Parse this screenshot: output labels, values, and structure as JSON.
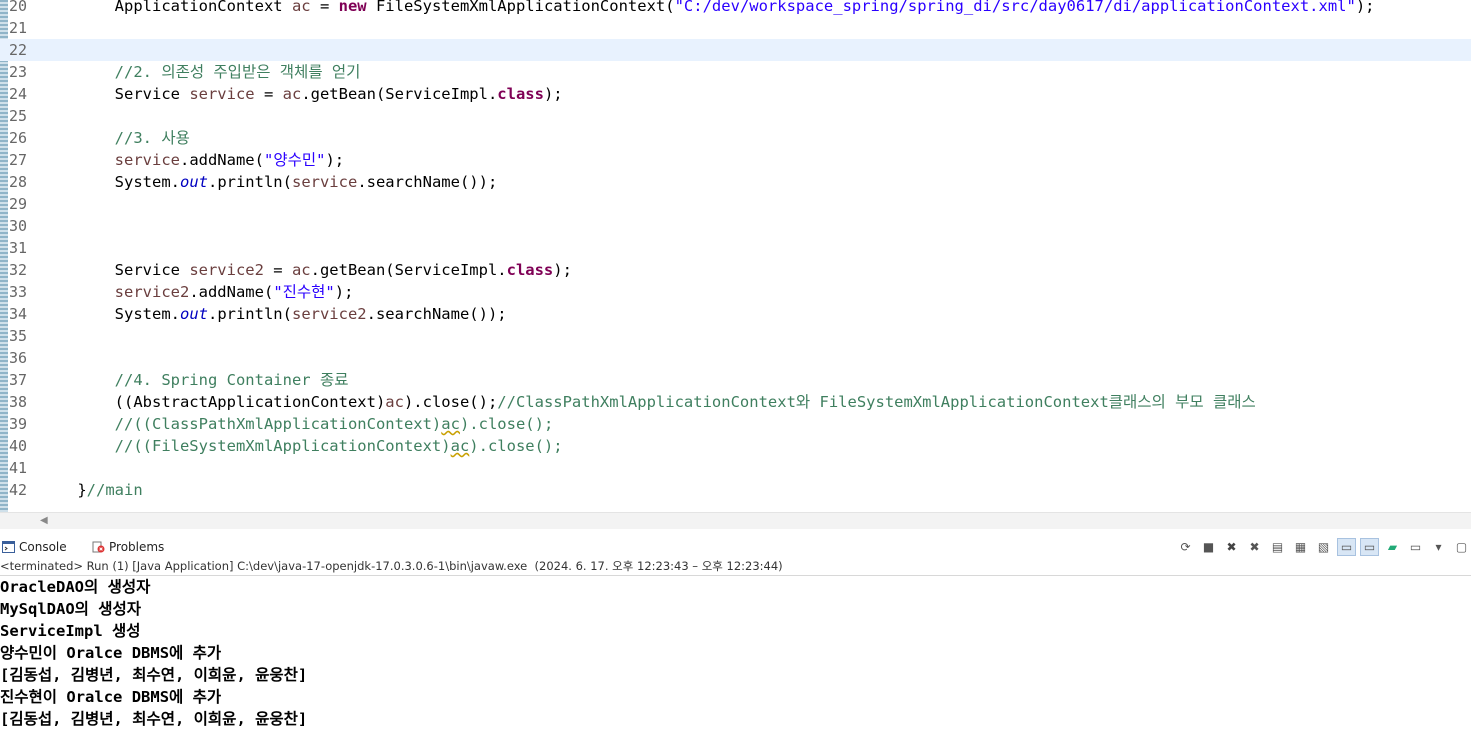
{
  "editor": {
    "lines": [
      {
        "num": "20",
        "segs": [
          {
            "t": "        ApplicationContext "
          },
          {
            "t": "ac",
            "c": "var"
          },
          {
            "t": " = "
          },
          {
            "t": "new",
            "c": "kw"
          },
          {
            "t": " FileSystemXmlApplicationContext("
          },
          {
            "t": "\"C:/dev/workspace_spring/spring_di/src/day0617/di/applicationContext.xml\"",
            "c": "str"
          },
          {
            "t": ");"
          }
        ]
      },
      {
        "num": "21",
        "segs": []
      },
      {
        "num": "22",
        "segs": [],
        "current": true
      },
      {
        "num": "23",
        "segs": [
          {
            "t": "        //2. 의존성 주입받은 객체를 얻기",
            "c": "cm"
          }
        ]
      },
      {
        "num": "24",
        "segs": [
          {
            "t": "        Service "
          },
          {
            "t": "service",
            "c": "var"
          },
          {
            "t": " = "
          },
          {
            "t": "ac",
            "c": "var"
          },
          {
            "t": ".getBean(ServiceImpl."
          },
          {
            "t": "class",
            "c": "kw"
          },
          {
            "t": ");"
          }
        ]
      },
      {
        "num": "25",
        "segs": []
      },
      {
        "num": "26",
        "segs": [
          {
            "t": "        //3. 사용",
            "c": "cm"
          }
        ]
      },
      {
        "num": "27",
        "segs": [
          {
            "t": "        "
          },
          {
            "t": "service",
            "c": "var"
          },
          {
            "t": ".addName("
          },
          {
            "t": "\"양수민\"",
            "c": "str"
          },
          {
            "t": ");"
          }
        ]
      },
      {
        "num": "28",
        "segs": [
          {
            "t": "        System."
          },
          {
            "t": "out",
            "c": "st"
          },
          {
            "t": ".println("
          },
          {
            "t": "service",
            "c": "var"
          },
          {
            "t": ".searchName());"
          }
        ]
      },
      {
        "num": "29",
        "segs": []
      },
      {
        "num": "30",
        "segs": []
      },
      {
        "num": "31",
        "segs": []
      },
      {
        "num": "32",
        "segs": [
          {
            "t": "        Service "
          },
          {
            "t": "service2",
            "c": "var"
          },
          {
            "t": " = "
          },
          {
            "t": "ac",
            "c": "var"
          },
          {
            "t": ".getBean(ServiceImpl."
          },
          {
            "t": "class",
            "c": "kw"
          },
          {
            "t": ");"
          }
        ]
      },
      {
        "num": "33",
        "segs": [
          {
            "t": "        "
          },
          {
            "t": "service2",
            "c": "var"
          },
          {
            "t": ".addName("
          },
          {
            "t": "\"진수현\"",
            "c": "str"
          },
          {
            "t": ");"
          }
        ]
      },
      {
        "num": "34",
        "segs": [
          {
            "t": "        System."
          },
          {
            "t": "out",
            "c": "st"
          },
          {
            "t": ".println("
          },
          {
            "t": "service2",
            "c": "var"
          },
          {
            "t": ".searchName());"
          }
        ]
      },
      {
        "num": "35",
        "segs": []
      },
      {
        "num": "36",
        "segs": []
      },
      {
        "num": "37",
        "segs": [
          {
            "t": "        //4. Spring Container 종료",
            "c": "cm"
          }
        ]
      },
      {
        "num": "38",
        "segs": [
          {
            "t": "        ((AbstractApplicationContext)"
          },
          {
            "t": "ac",
            "c": "var"
          },
          {
            "t": ").close();"
          },
          {
            "t": "//ClassPathXmlApplicationContext와 FileSystemXmlApplicationContext클래스의 부모 클래스",
            "c": "cm"
          }
        ]
      },
      {
        "num": "39",
        "segs": [
          {
            "t": "        //((ClassPathXmlApplicationContext)",
            "c": "cm"
          },
          {
            "t": "ac",
            "c": "cm wavy"
          },
          {
            "t": ").close();",
            "c": "cm"
          }
        ]
      },
      {
        "num": "40",
        "segs": [
          {
            "t": "        //((FileSystemXmlApplicationContext)",
            "c": "cm"
          },
          {
            "t": "ac",
            "c": "cm wavy"
          },
          {
            "t": ").close();",
            "c": "cm"
          }
        ]
      },
      {
        "num": "41",
        "segs": []
      },
      {
        "num": "42",
        "segs": [
          {
            "t": "    }"
          },
          {
            "t": "//main",
            "c": "cm"
          }
        ]
      }
    ]
  },
  "console": {
    "tabs": {
      "console": "Console",
      "problems": "Problems"
    },
    "status": "<terminated> Run (1) [Java Application] C:\\dev\\java-17-openjdk-17.0.3.0.6-1\\bin\\javaw.exe  (2024. 6. 17. 오후 12:23:43 – 오후 12:23:44)",
    "output": [
      "OracleDAO의 생성자",
      "MySqlDAO의 생성자",
      "ServiceImpl 생성",
      "양수민이 Oralce DBMS에 추가",
      "[김동섭, 김병년, 최수연, 이희윤, 윤웅찬]",
      "진수현이 Oralce DBMS에 추가",
      "[김동섭, 김병년, 최수연, 이희윤, 윤웅찬]"
    ]
  },
  "icons": [
    "console-icon",
    "problems-icon",
    "remove-launch-icon",
    "terminate-icon",
    "remove-all-icon",
    "clear-console-icon",
    "scroll-lock-icon",
    "word-wrap-icon",
    "show-on-stdout-icon",
    "show-on-stderr-icon",
    "pin-console-icon",
    "display-console-icon",
    "open-console-icon"
  ]
}
